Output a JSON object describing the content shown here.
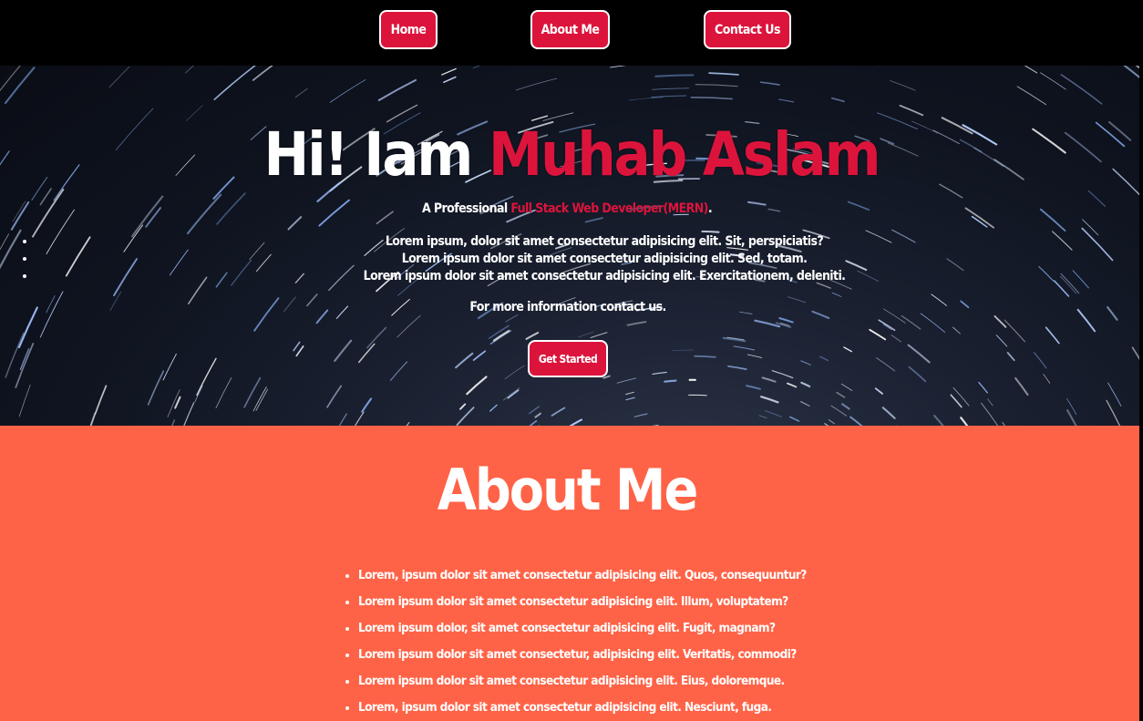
{
  "nav": {
    "home": "Home",
    "about": "About Me",
    "contact": "Contact Us"
  },
  "hero": {
    "title_prefix": "Hi! Iam",
    "title_name": "Muhab Aslam",
    "sub_prefix": "A Professional",
    "sub_role": "Full Stack Web Developer(MERN)",
    "sub_suffix": ".",
    "bullets": [
      "Lorem ipsum, dolor sit amet consectetur adipisicing elit. Sit, perspiciatis?",
      "Lorem ipsum dolor sit amet consectetur adipisicing elit. Sed, totam.",
      "Lorem ipsum dolor sit amet consectetur adipisicing elit. Exercitationem, deleniti."
    ],
    "more": "For more information contact us.",
    "cta": "Get Started"
  },
  "about": {
    "title": "About Me",
    "items": [
      "Lorem, ipsum dolor sit amet consectetur adipisicing elit. Quos, consequuntur?",
      "Lorem ipsum dolor sit amet consectetur adipisicing elit. Illum, voluptatem?",
      "Lorem ipsum dolor, sit amet consectetur adipisicing elit. Fugit, magnam?",
      "Lorem ipsum dolor sit amet consectetur, adipisicing elit. Veritatis, commodi?",
      "Lorem ipsum dolor sit amet consectetur adipisicing elit. Eius, doloremque.",
      "Lorem, ipsum dolor sit amet consectetur adipisicing elit. Nesciunt, fuga."
    ]
  },
  "colors": {
    "accent": "#dc143c",
    "about_bg": "#ff6347",
    "nav_bg": "#000000"
  }
}
